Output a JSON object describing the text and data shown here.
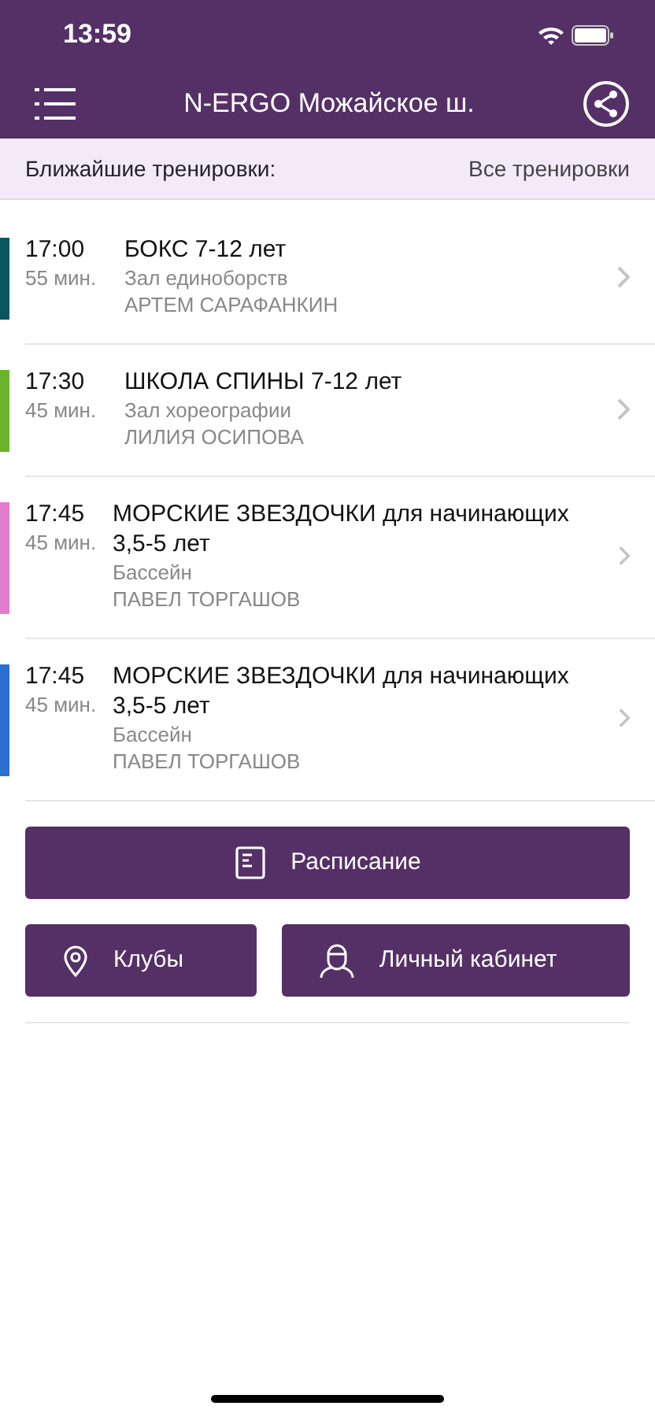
{
  "status_bar": {
    "time": "13:59"
  },
  "header": {
    "title": "N-ERGO Можайское ш."
  },
  "subheader": {
    "label": "Ближайшие тренировки:",
    "link": "Все тренировки"
  },
  "trainings": [
    {
      "time": "17:00",
      "duration": "55 мин.",
      "title": "БОКС 7-12 лет",
      "room": "Зал единоборств",
      "coach": "АРТЕМ САРАФАНКИН",
      "color": "#0b5560"
    },
    {
      "time": "17:30",
      "duration": "45 мин.",
      "title": "ШКОЛА СПИНЫ 7-12 лет",
      "room": "Зал хореографии",
      "coach": "ЛИЛИЯ ОСИПОВА",
      "color": "#6ab42c"
    },
    {
      "time": "17:45",
      "duration": "45 мин.",
      "title": "МОРСКИЕ ЗВЕЗДОЧКИ для начинающих 3,5-5 лет",
      "room": "Бассейн",
      "coach": "ПАВЕЛ ТОРГАШОВ",
      "color": "#e07ccb"
    },
    {
      "time": "17:45",
      "duration": "45 мин.",
      "title": "МОРСКИЕ ЗВЕЗДОЧКИ для начинающих 3,5-5 лет",
      "room": "Бассейн",
      "coach": "ПАВЕЛ ТОРГАШОВ",
      "color": "#2b6fd0"
    }
  ],
  "buttons": [
    {
      "label": "Расписание",
      "kind": "schedule"
    },
    {
      "label": "Клубы",
      "kind": "clubs"
    },
    {
      "label": "Личный кабинет",
      "kind": "profile"
    }
  ]
}
